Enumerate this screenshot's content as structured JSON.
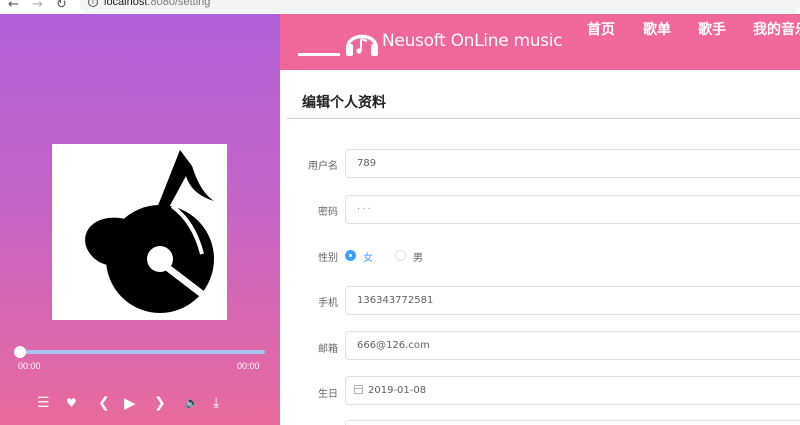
{
  "browser": {
    "url_host": "localhost",
    "url_path": ":8080/setting"
  },
  "player": {
    "current_time": "00:00",
    "total_time": "00:00",
    "progress": 0,
    "controls": [
      "list-icon",
      "heart-icon",
      "prev-icon",
      "play-icon",
      "next-icon",
      "volume-icon",
      "download-icon"
    ]
  },
  "header": {
    "logo_text": "Neusoft OnLine music",
    "nav": [
      {
        "label": "首页",
        "active": true
      },
      {
        "label": "歌单",
        "active": false
      },
      {
        "label": "歌手",
        "active": false
      },
      {
        "label": "我的音乐",
        "active": false
      }
    ]
  },
  "page": {
    "title": "编辑个人资料"
  },
  "form": {
    "username_label": "用户名",
    "username_value": "789",
    "password_label": "密码",
    "password_value": "···",
    "gender_label": "性别",
    "gender_female": "女",
    "gender_male": "男",
    "gender_selected": "女",
    "phone_label": "手机",
    "phone_value": "136343772581",
    "email_label": "邮箱",
    "email_value": "666@126.com",
    "birthday_label": "生日",
    "birthday_value": "2019-01-08"
  },
  "colors": {
    "header_pink": "#f0679c",
    "player_top": "#b15fd9",
    "player_bottom": "#e96a9d",
    "accent_blue": "#409eff"
  }
}
